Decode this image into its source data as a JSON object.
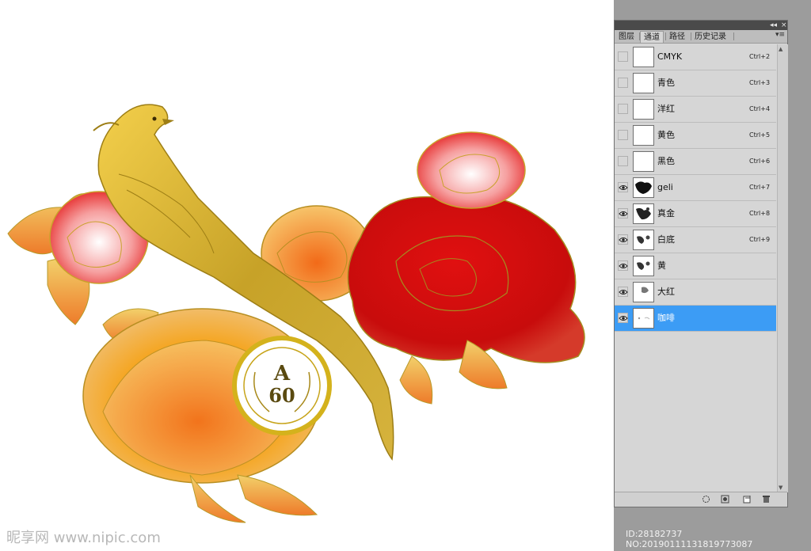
{
  "panel": {
    "collapse_glyph": "◂◂",
    "close_glyph": "×",
    "menu_glyph": "▾≡",
    "tabs": [
      {
        "label": "图层"
      },
      {
        "label": "通道"
      },
      {
        "label": "路径"
      },
      {
        "label": "历史记录"
      }
    ],
    "channels": [
      {
        "name": "CMYK",
        "shortcut": "Ctrl+2",
        "visible": false,
        "selected": false,
        "thumb": "blank"
      },
      {
        "name": "青色",
        "shortcut": "Ctrl+3",
        "visible": false,
        "selected": false,
        "thumb": "blank"
      },
      {
        "name": "洋红",
        "shortcut": "Ctrl+4",
        "visible": false,
        "selected": false,
        "thumb": "blank"
      },
      {
        "name": "黄色",
        "shortcut": "Ctrl+5",
        "visible": false,
        "selected": false,
        "thumb": "blank"
      },
      {
        "name": "黑色",
        "shortcut": "Ctrl+6",
        "visible": false,
        "selected": false,
        "thumb": "blank"
      },
      {
        "name": "geli",
        "shortcut": "Ctrl+7",
        "visible": true,
        "selected": false,
        "thumb": "dense"
      },
      {
        "name": "真金",
        "shortcut": "Ctrl+8",
        "visible": true,
        "selected": false,
        "thumb": "medium"
      },
      {
        "name": "白底",
        "shortcut": "Ctrl+9",
        "visible": true,
        "selected": false,
        "thumb": "sparse"
      },
      {
        "name": "黄",
        "shortcut": "",
        "visible": true,
        "selected": false,
        "thumb": "sparse"
      },
      {
        "name": "大红",
        "shortcut": "",
        "visible": true,
        "selected": false,
        "thumb": "light"
      },
      {
        "name": "咖啡",
        "shortcut": "",
        "visible": true,
        "selected": true,
        "thumb": "faint"
      }
    ],
    "scroll_up_glyph": "▲",
    "scroll_down_glyph": "▼"
  },
  "artwork": {
    "badge_letter": "A",
    "badge_number": "60"
  },
  "watermark": {
    "left_text": "昵享网 www.nipic.com",
    "right_text": "ID:28182737 NO:20190111131819773087"
  },
  "colors": {
    "selection": "#3c9cf5",
    "panel_bg": "#d6d6d6",
    "workspace_bg": "#9c9c9c"
  }
}
